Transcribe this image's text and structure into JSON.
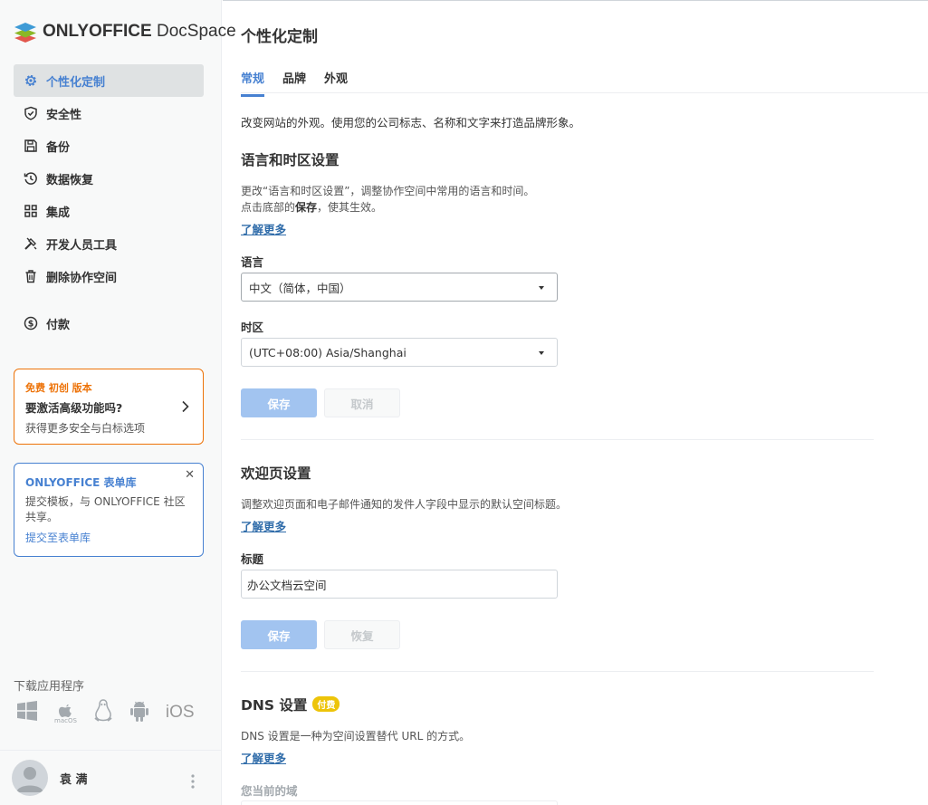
{
  "app": {
    "logo_brand": "ONLYOFFICE",
    "logo_product": "DocSpace"
  },
  "sidebar": {
    "items": [
      {
        "label": "个性化定制",
        "icon": "gear-icon"
      },
      {
        "label": "安全性",
        "icon": "shield-icon"
      },
      {
        "label": "备份",
        "icon": "save-icon"
      },
      {
        "label": "数据恢复",
        "icon": "history-icon"
      },
      {
        "label": "集成",
        "icon": "grid-icon"
      },
      {
        "label": "开发人员工具",
        "icon": "tools-icon"
      },
      {
        "label": "删除协作空间",
        "icon": "trash-icon"
      },
      {
        "label": "付款",
        "icon": "dollar-icon"
      }
    ],
    "promo": {
      "tag": "免费 初创 版本",
      "heading": "要激活高级功能吗?",
      "subtitle": "获得更多安全与白标选项"
    },
    "forms": {
      "heading": "ONLYOFFICE 表单库",
      "text": "提交模板，与 ONLYOFFICE 社区共享。",
      "link": "提交至表单库"
    },
    "download_label": "下载应用程序",
    "apps": [
      "windows-icon",
      "macos-icon",
      "linux-icon",
      "android-icon",
      "ios-icon"
    ],
    "apps_macos_caption": "macOS",
    "apps_ios_label": "iOS",
    "user_name": "袁 满"
  },
  "main": {
    "title": "个性化定制",
    "tabs": [
      {
        "label": "常规",
        "active": true
      },
      {
        "label": "品牌",
        "active": false
      },
      {
        "label": "外观",
        "active": false
      }
    ],
    "intro": "改变网站的外观。使用您的公司标志、名称和文字来打造品牌形象。",
    "language_section": {
      "title": "语言和时区设置",
      "desc_line1": "更改“语言和时区设置”，调整协作空间中常用的语言和时间。",
      "desc_line2_pre": "点击底部的",
      "desc_line2_bold": "保存",
      "desc_line2_post": "，使其生效。",
      "learn_more": "了解更多",
      "language_label": "语言",
      "language_value": "中文（简体，中国）",
      "timezone_label": "时区",
      "timezone_value": "(UTC+08:00) Asia/Shanghai",
      "save": "保存",
      "cancel": "取消"
    },
    "welcome_section": {
      "title": "欢迎页设置",
      "desc": "调整欢迎页面和电子邮件通知的发件人字段中显示的默认空间标题。",
      "learn_more": "了解更多",
      "title_label": "标题",
      "title_value": "办公文档云空间",
      "save": "保存",
      "restore": "恢复"
    },
    "dns_section": {
      "title": "DNS 设置",
      "badge": "付费",
      "desc": "DNS 设置是一种为空间设置替代 URL 的方式。",
      "learn_more": "了解更多",
      "domain_label": "您当前的域"
    }
  },
  "colors": {
    "accent": "#4781d1",
    "promo_orange": "#ed7309",
    "badge_yellow": "#edc409",
    "disabled_primary": "#a2c4f0"
  }
}
